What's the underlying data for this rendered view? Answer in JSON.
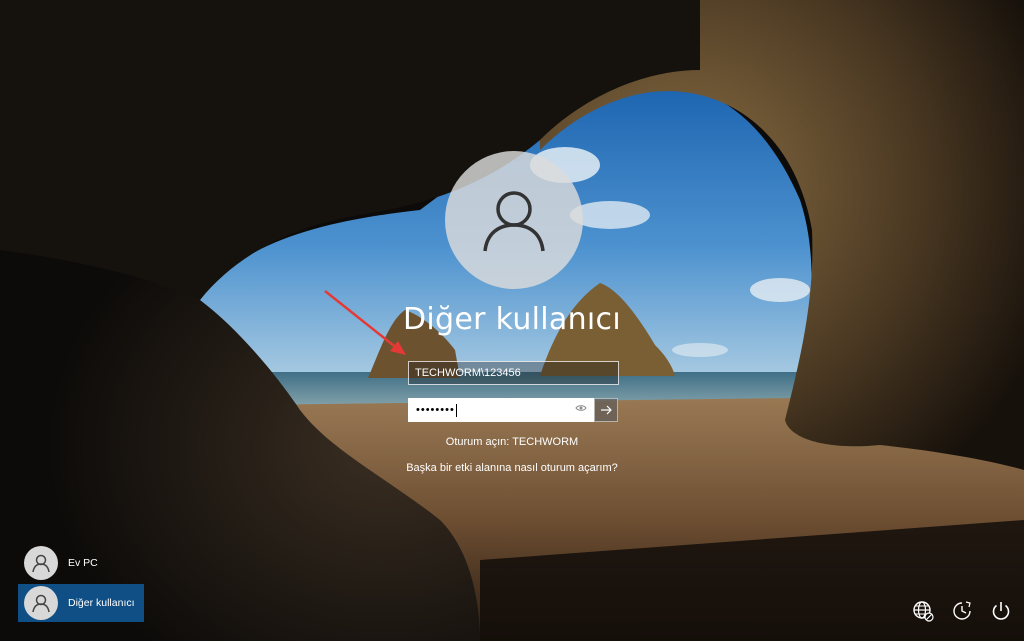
{
  "login": {
    "display_name": "Diğer kullanıcı",
    "username_value": "TECHWORM\\123456",
    "password_mask": "••••••••",
    "sign_in_to": "Oturum açın: TECHWORM",
    "other_domain_help": "Başka bir etki alanına nasıl oturum açarım?"
  },
  "users": [
    {
      "name": "Ev PC",
      "selected": false
    },
    {
      "name": "Diğer kullanıcı",
      "selected": true
    }
  ],
  "tray": {
    "icons": [
      "network-icon",
      "ease-of-access-icon",
      "power-icon"
    ]
  },
  "colors": {
    "selected_user": "#0f4f85",
    "annotation_arrow": "#e53935"
  }
}
